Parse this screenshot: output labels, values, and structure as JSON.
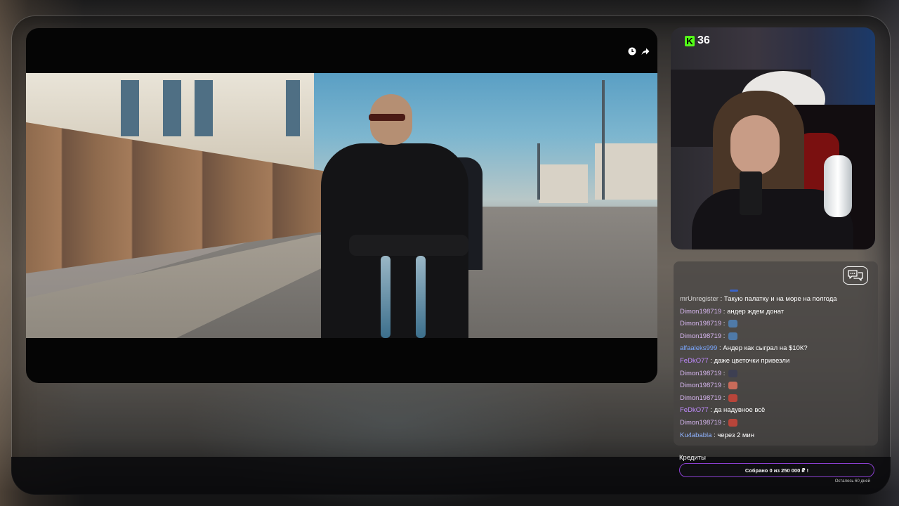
{
  "platform": {
    "name": "Kick",
    "brand_color": "#53fc18",
    "viewer_count": "36"
  },
  "player": {
    "icons": [
      "clock-icon",
      "share-icon"
    ]
  },
  "chat": {
    "toggle_icon": "chat-bubbles-icon",
    "messages": [
      {
        "user": "mrUnregister",
        "color": "#d6d6d6",
        "text": "Такую палатку и на море на полгода",
        "emote": null
      },
      {
        "user": "Dimon198719",
        "color": "#d7b6f0",
        "text": "андер ждем донат",
        "emote": null
      },
      {
        "user": "Dimon198719",
        "color": "#d7b6f0",
        "text": "",
        "emote": "#4f7aa8"
      },
      {
        "user": "Dimon198719",
        "color": "#d7b6f0",
        "text": "",
        "emote": "#4f7aa8"
      },
      {
        "user": "alfaaleks999",
        "color": "#7aa7ff",
        "text": "Андер как сыграл на $10К?",
        "emote": null
      },
      {
        "user": "FeDkO77",
        "color": "#c08bff",
        "text": "даже цветочки привезли",
        "emote": null
      },
      {
        "user": "Dimon198719",
        "color": "#d7b6f0",
        "text": "",
        "emote": "#3d3f52"
      },
      {
        "user": "Dimon198719",
        "color": "#d7b6f0",
        "text": "",
        "emote": "#c96b5a"
      },
      {
        "user": "Dimon198719",
        "color": "#d7b6f0",
        "text": "",
        "emote": "#b8453a"
      },
      {
        "user": "FeDkO77",
        "color": "#c08bff",
        "text": "да надувное всё",
        "emote": null
      },
      {
        "user": "Dimon198719",
        "color": "#d7b6f0",
        "text": "",
        "emote": "#b8453a"
      },
      {
        "user": "Ku4ababla",
        "color": "#8fb4ff",
        "text": "через 2 мин",
        "emote": null
      }
    ]
  },
  "credits": {
    "title": "Кредиты",
    "progress_label": "Собрано 0  из 250 000 ₽ !",
    "collected": 0,
    "goal": 250000,
    "remaining_label": "Осталось 60 дней",
    "accent_color": "#8a3fd0"
  }
}
